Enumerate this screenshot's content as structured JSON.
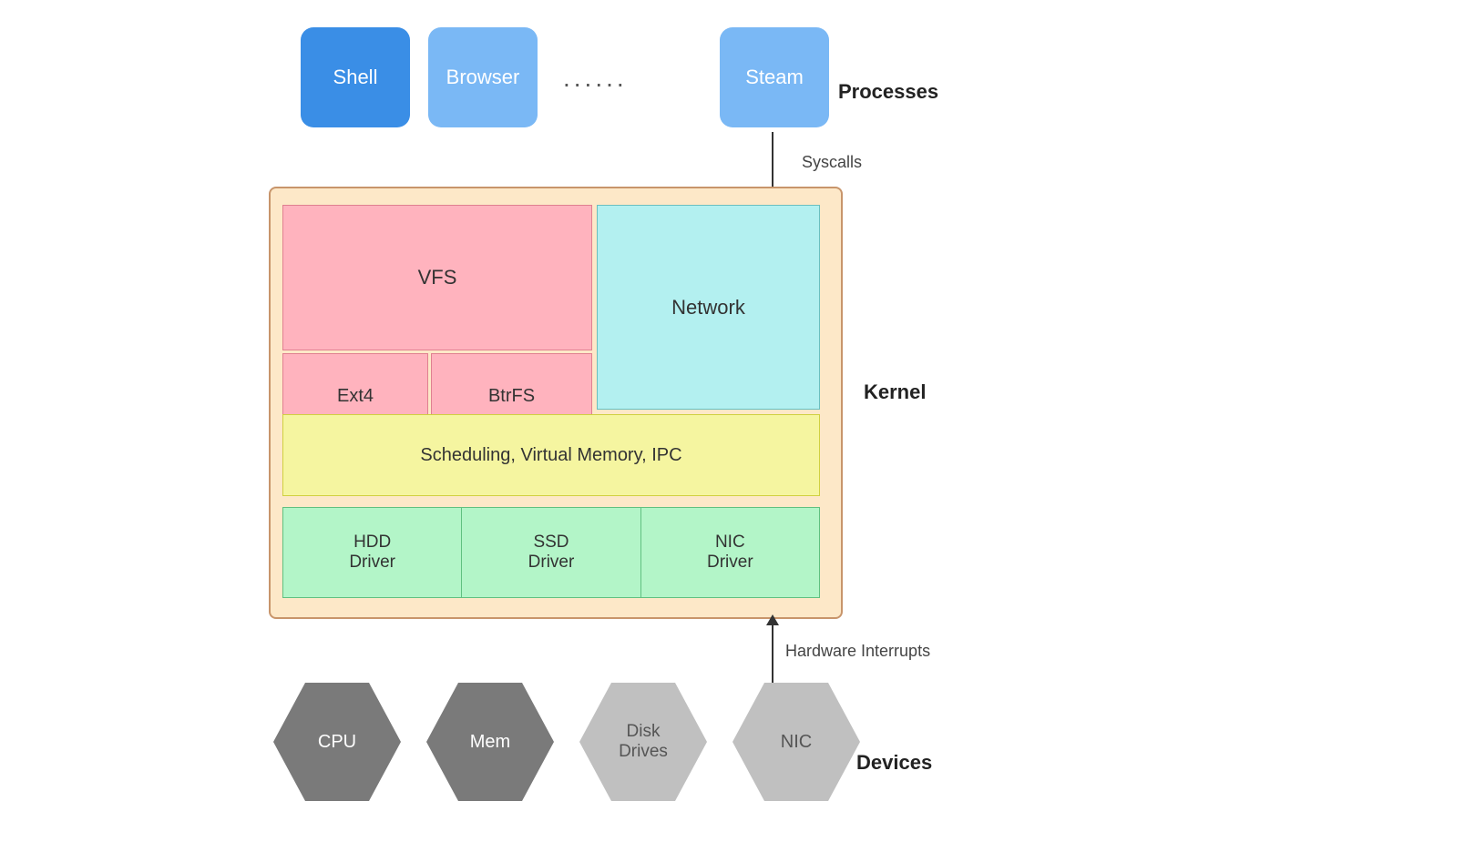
{
  "processes": {
    "label": "Processes",
    "shell": "Shell",
    "browser": "Browser",
    "dots": "......",
    "steam": "Steam",
    "syscalls": "Syscalls"
  },
  "kernel": {
    "label": "Kernel",
    "vfs": "VFS",
    "network": "Network",
    "ext4": "Ext4",
    "btrfs": "BtrFS",
    "scheduling": "Scheduling, Virtual Memory, IPC",
    "hdd_driver": "HDD\nDriver",
    "ssd_driver": "SSD\nDriver",
    "nic_driver": "NIC\nDriver"
  },
  "devices": {
    "label": "Devices",
    "hw_interrupts": "Hardware Interrupts",
    "cpu": "CPU",
    "mem": "Mem",
    "disk": "Disk\nDrives",
    "nic": "NIC"
  }
}
